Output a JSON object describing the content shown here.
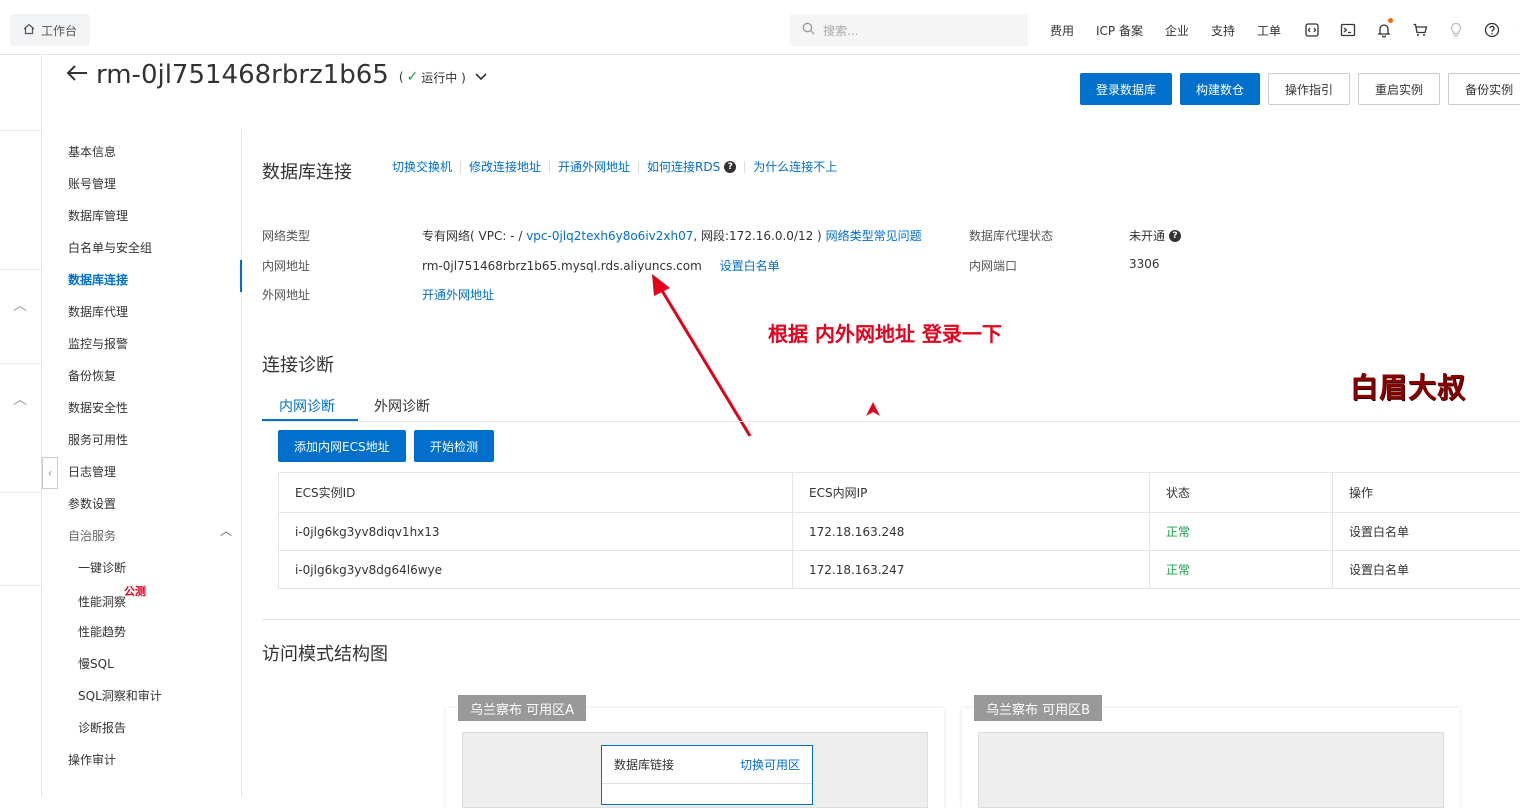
{
  "topbar": {
    "workspace": "工作台",
    "search_placeholder": "搜索...",
    "nav": [
      "费用",
      "ICP 备案",
      "企业",
      "支持",
      "工单"
    ],
    "lang_char": "简"
  },
  "header": {
    "title": "rm-0jl751468rbrz1b65",
    "status_open": "(",
    "status_text": "运行中 )"
  },
  "actions": {
    "login_db": "登录数据库",
    "build_lake": "构建数仓",
    "guide": "操作指引",
    "restart": "重启实例",
    "backup": "备份实例"
  },
  "sidebar": {
    "items": [
      "基本信息",
      "账号管理",
      "数据库管理",
      "白名单与安全组",
      "数据库连接",
      "数据库代理",
      "监控与报警",
      "备份恢复",
      "数据安全性",
      "服务可用性",
      "日志管理",
      "参数设置",
      "自治服务"
    ],
    "sub_items": [
      "一键诊断",
      "性能洞察",
      "性能趋势",
      "慢SQL",
      "SQL洞察和审计",
      "诊断报告"
    ],
    "after": "操作审计",
    "beta": "公测"
  },
  "connection": {
    "title": "数据库连接",
    "links": [
      "切换交换机",
      "修改连接地址",
      "开通外网地址",
      "如何连接RDS",
      "为什么连接不上"
    ],
    "network_type_label": "网络类型",
    "network_type_prefix": "专有网络( VPC: - / ",
    "vpc_id": "vpc-0jlq2texh6y8o6iv2xh07",
    "network_segment": ", 网段:172.16.0.0/12 )",
    "network_faq": "网络类型常见问题",
    "inner_addr_label": "内网地址",
    "inner_addr": "rm-0jl751468rbrz1b65.mysql.rds.aliyuncs.com",
    "set_whitelist": "设置白名单",
    "outer_addr_label": "外网地址",
    "open_outer": "开通外网地址",
    "proxy_label": "数据库代理状态",
    "proxy_value": "未开通",
    "port_label": "内网端口",
    "port_value": "3306"
  },
  "annotation": "根据 内外网地址  登录一下",
  "watermark": "白眉大叔",
  "diagnosis": {
    "title": "连接诊断",
    "tabs": [
      "内网诊断",
      "外网诊断"
    ],
    "add_button": "添加内网ECS地址",
    "start_button": "开始检测",
    "columns": [
      "ECS实例ID",
      "ECS内网IP",
      "状态",
      "操作"
    ],
    "rows": [
      {
        "id": "i-0jlg6kg3yv8diqv1hx13",
        "ip": "172.18.163.248",
        "status": "正常",
        "op": "设置白名单"
      },
      {
        "id": "i-0jlg6kg3yv8dg64l6wye",
        "ip": "172.18.163.247",
        "status": "正常",
        "op": "设置白名单"
      }
    ]
  },
  "access": {
    "title": "访问模式结构图",
    "zone_a": "乌兰察布 可用区A",
    "zone_b": "乌兰察布 可用区B",
    "db_link": "数据库链接",
    "switch_zone": "切换可用区"
  },
  "colors": {
    "primary": "#0070cc",
    "success": "#1aa04b",
    "annotation": "#e5001b",
    "watermark": "#8b0000"
  }
}
